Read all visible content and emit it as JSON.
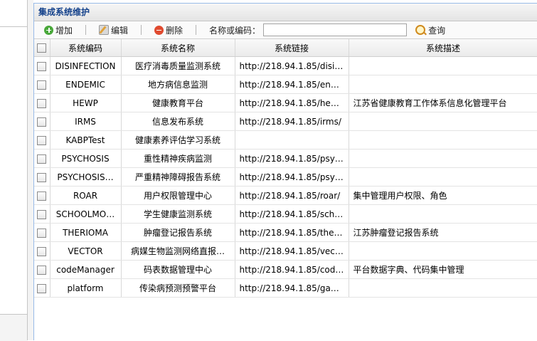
{
  "panel": {
    "title": "集成系统维护"
  },
  "toolbar": {
    "add_label": "增加",
    "edit_label": "编辑",
    "delete_label": "删除",
    "search_label": "名称或编码：",
    "search_value": "",
    "query_label": "查询"
  },
  "table": {
    "headers": {
      "code": "系统编码",
      "name": "系统名称",
      "link": "系统链接",
      "desc": "系统描述"
    },
    "rows": [
      {
        "code": "DISINFECTION",
        "name": "医疗消毒质量监测系统",
        "link": "http://218.94.1.85/disinf…",
        "desc": ""
      },
      {
        "code": "ENDEMIC",
        "name": "地方病信息监测",
        "link": "http://218.94.1.85/ende…",
        "desc": ""
      },
      {
        "code": "HEWP",
        "name": "健康教育平台",
        "link": "http://218.94.1.85/hewp/",
        "desc": "江苏省健康教育工作体系信息化管理平台"
      },
      {
        "code": "IRMS",
        "name": "信息发布系统",
        "link": "http://218.94.1.85/irms/",
        "desc": ""
      },
      {
        "code": "KABPTest",
        "name": "健康素养评估学习系统",
        "link": "",
        "desc": ""
      },
      {
        "code": "PSYCHOSIS",
        "name": "重性精神疾病监测",
        "link": "http://218.94.1.85/psych…",
        "desc": ""
      },
      {
        "code": "PSYCHOSIS…",
        "name": "严重精神障碍报告系统",
        "link": "http://218.94.1.85/psych…",
        "desc": ""
      },
      {
        "code": "ROAR",
        "name": "用户权限管理中心",
        "link": "http://218.94.1.85/roar/",
        "desc": "集中管理用户权限、角色"
      },
      {
        "code": "SCHOOLMO…",
        "name": "学生健康监测系统",
        "link": "http://218.94.1.85/schoo…",
        "desc": ""
      },
      {
        "code": "THERIOMA",
        "name": "肿瘤登记报告系统",
        "link": "http://218.94.1.85/therio…",
        "desc": "江苏肿瘤登记报告系统"
      },
      {
        "code": "VECTOR",
        "name": "病媒生物监测网络直报…",
        "link": "http://218.94.1.85/vector",
        "desc": ""
      },
      {
        "code": "codeManager",
        "name": "码表数据管理中心",
        "link": "http://218.94.1.85/code…",
        "desc": "平台数据字典、代码集中管理"
      },
      {
        "code": "platform",
        "name": "传染病预测预警平台",
        "link": "http://218.94.1.85/ganni…",
        "desc": ""
      }
    ]
  }
}
